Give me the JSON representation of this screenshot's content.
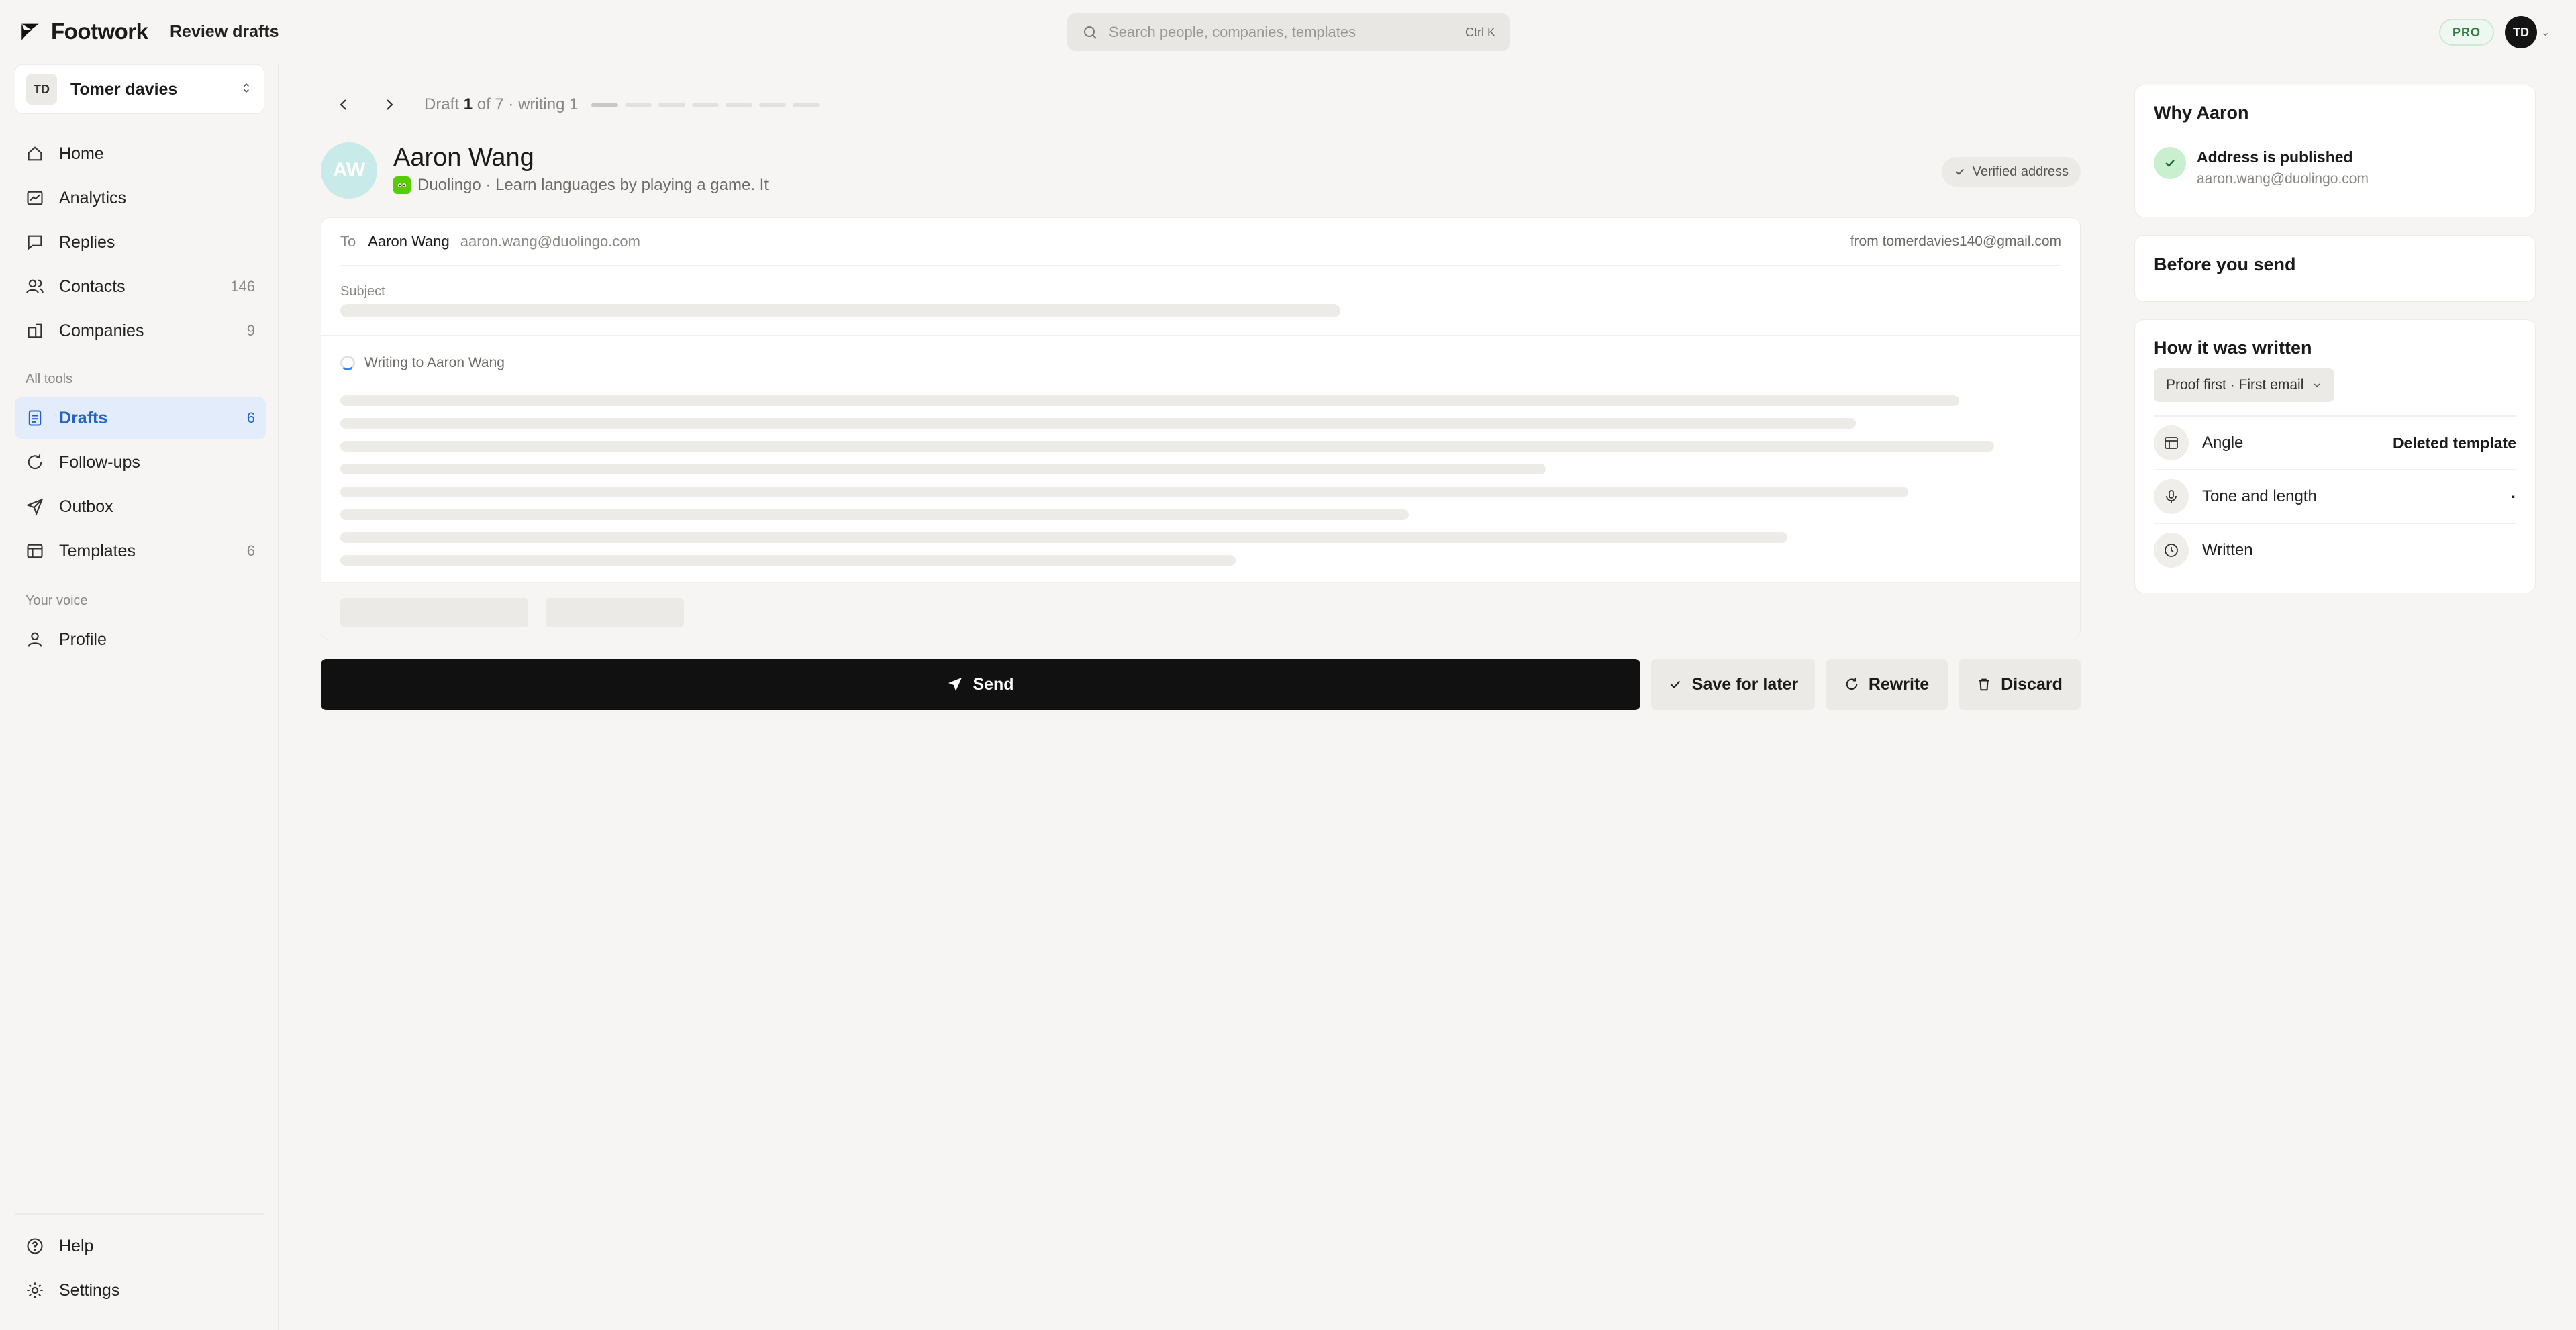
{
  "app": {
    "name": "Footwork",
    "breadcrumb": "Review drafts"
  },
  "search": {
    "placeholder": "Search people, companies, templates",
    "shortcut": "Ctrl K"
  },
  "account": {
    "plan_badge": "PRO",
    "avatar_initials": "TD",
    "caret": "⌄"
  },
  "workspace": {
    "initials": "TD",
    "name": "Tomer davies"
  },
  "sidebar": {
    "items": [
      {
        "label": "Home",
        "count": ""
      },
      {
        "label": "Analytics",
        "count": ""
      },
      {
        "label": "Replies",
        "count": ""
      },
      {
        "label": "Contacts",
        "count": "146"
      },
      {
        "label": "Companies",
        "count": "9"
      }
    ],
    "section_tools": "All tools",
    "tools": [
      {
        "label": "Drafts",
        "count": "6",
        "active": true
      },
      {
        "label": "Follow-ups",
        "count": ""
      },
      {
        "label": "Outbox",
        "count": ""
      },
      {
        "label": "Templates",
        "count": "6"
      }
    ],
    "section_voice": "Your voice",
    "voice": [
      {
        "label": "Profile"
      }
    ],
    "bottom": [
      {
        "label": "Help"
      },
      {
        "label": "Settings"
      }
    ]
  },
  "pager": {
    "prefix": "Draft",
    "current": "1",
    "suffix": "of 7 · writing 1",
    "total_steps": 7,
    "completed_steps": 1
  },
  "contact": {
    "initials": "AW",
    "name": "Aaron Wang",
    "company_line": "Duolingo · Learn languages by playing a game. It",
    "verified_label": "Verified address"
  },
  "email": {
    "to_label": "To",
    "to_name": "Aaron Wang",
    "to_email": "aaron.wang@duolingo.com",
    "from_text": "from tomerdavies140@gmail.com",
    "subject_label": "Subject",
    "status_text": "Writing to Aaron Wang"
  },
  "actions": {
    "send": "Send",
    "save": "Save for later",
    "rewrite": "Rewrite",
    "discard": "Discard"
  },
  "why_panel": {
    "title": "Why Aaron",
    "item_title": "Address is published",
    "item_detail": "aaron.wang@duolingo.com"
  },
  "before_panel": {
    "title": "Before you send"
  },
  "how_panel": {
    "title": "How it was written",
    "chip": "Proof first · First email",
    "rows": [
      {
        "label": "Angle",
        "value": "Deleted template"
      },
      {
        "label": "Tone and length",
        "value": "·"
      },
      {
        "label": "Written",
        "value": ""
      }
    ]
  },
  "colors": {
    "background": "#f6f5f3",
    "accent_blue": "#2563c9",
    "active_bg": "#e3ecfb",
    "send_button": "#111111",
    "success_green": "#c9efcf",
    "avatar_teal": "#c8eae8"
  }
}
